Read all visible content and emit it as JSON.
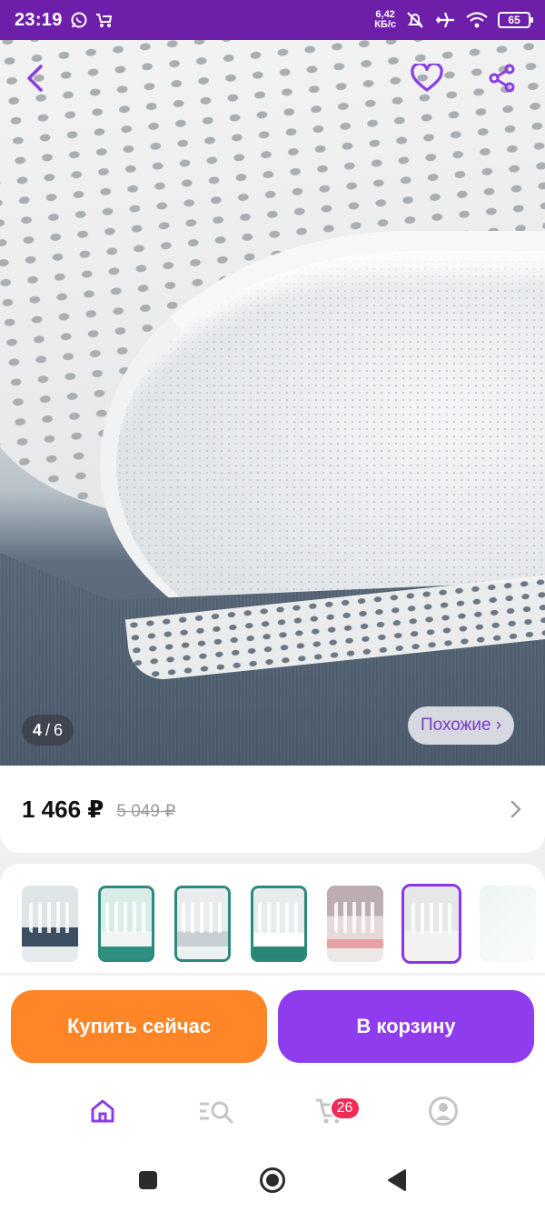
{
  "status_bar": {
    "time": "23:19",
    "speed_value": "6,42",
    "speed_unit": "КБ/с",
    "battery": "65"
  },
  "gallery": {
    "current": "4",
    "separator": "/",
    "total": "6",
    "similar_label": "Похожие ›"
  },
  "product": {
    "price": "1 466 ₽",
    "old_price": "5 049 ₽"
  },
  "actions": {
    "buy_now": "Купить сейчас",
    "add_to_cart": "В корзину"
  },
  "bottom_nav": {
    "cart_badge": "26"
  },
  "colors": {
    "status_bar": "#6e1fa9",
    "brand_purple": "#8f3cef",
    "buy_orange": "#ff8526",
    "badge_red": "#f22a56"
  },
  "icons": [
    "whatsapp-icon",
    "stroller-icon",
    "bell-off-icon",
    "airplane-icon",
    "wifi-icon",
    "battery-icon",
    "back-arrow-icon",
    "heart-icon",
    "share-icon",
    "chevron-right-icon",
    "home-icon",
    "catalog-search-icon",
    "cart-icon",
    "profile-icon",
    "recents-icon",
    "home-circle-icon",
    "back-triangle-icon"
  ]
}
